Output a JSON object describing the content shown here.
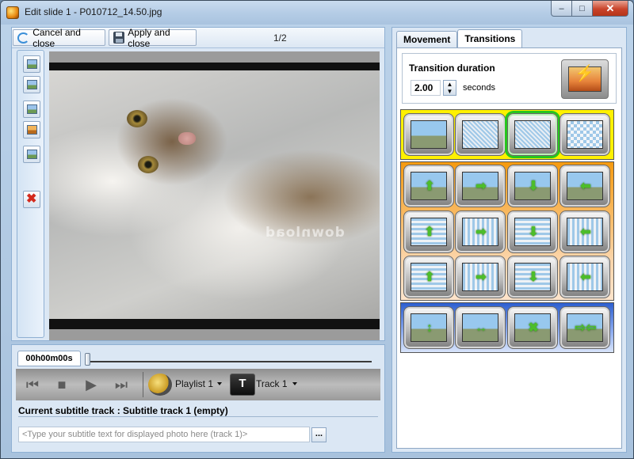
{
  "window": {
    "title": "Edit slide 1 - P010712_14.50.jpg",
    "min_label": "‒",
    "max_label": "□",
    "close_label": "✕"
  },
  "toolbar": {
    "cancel_label": "Cancel and close",
    "apply_label": "Apply and close",
    "page_count": "1/2"
  },
  "preview": {
    "watermark": "download"
  },
  "timeline": {
    "time": "00h00m00s"
  },
  "player": {
    "prev_glyph": "⏮",
    "stop_glyph": "■",
    "play_glyph": "▶",
    "next_glyph": "⏭",
    "playlist_label": "Playlist 1",
    "track_label": "Track 1",
    "track_icon_glyph": "T"
  },
  "subtitle": {
    "current_track_label": "Current subtitle track : Subtitle track 1 (empty)",
    "placeholder": "<Type your subtitle text for displayed photo here (track 1)>",
    "ellipsis_label": "..."
  },
  "right_panel": {
    "tabs": [
      {
        "label": "Movement"
      },
      {
        "label": "Transitions"
      }
    ],
    "duration_title": "Transition duration",
    "duration_value": "2.00",
    "duration_unit": "seconds",
    "spin_up": "▲",
    "spin_down": "▼"
  },
  "transitions": {
    "selected": "dissolve",
    "items": [
      "fade",
      "noise",
      "dissolve",
      "checker",
      "slide-up",
      "slide-right",
      "slide-down",
      "slide-left",
      "blinds-h-up",
      "blinds-v-right",
      "blinds-h-down",
      "blinds-v-left",
      "bars-h-up",
      "bars-v-right",
      "bars-h-down",
      "bars-v-left",
      "split-vertical",
      "split-horizontal",
      "zoom-center",
      "merge-horizontal"
    ]
  },
  "colors": {
    "title_bar": "#b5cde6",
    "selection": "#26c61d",
    "group_yellow": "#fff100",
    "group_orange": "#f59a10",
    "group_blue": "#2d5fd0"
  }
}
